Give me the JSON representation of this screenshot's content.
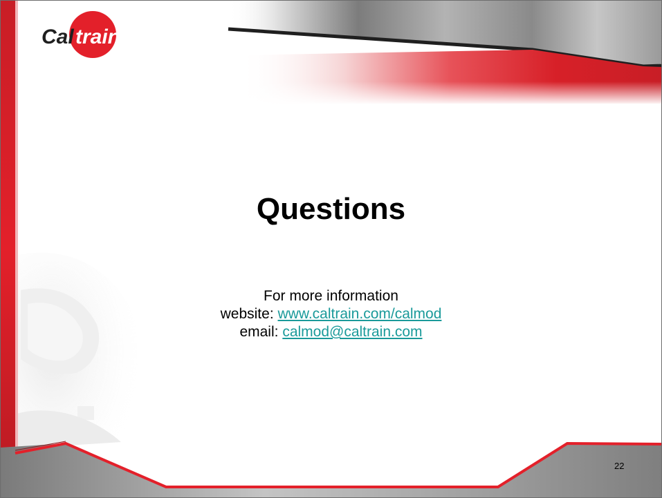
{
  "logo": {
    "text_part1": "Cal",
    "text_part2": "train"
  },
  "slide": {
    "title": "Questions",
    "info_heading": "For more information",
    "website_label": "website: ",
    "website_link": "www.caltrain.com/calmod",
    "email_label": "email: ",
    "email_link": "calmod@caltrain.com",
    "page_number": "22"
  },
  "colors": {
    "brand_red": "#e3202a",
    "link_teal": "#1a9a9a",
    "frame_gray": "#6d6d6d"
  }
}
